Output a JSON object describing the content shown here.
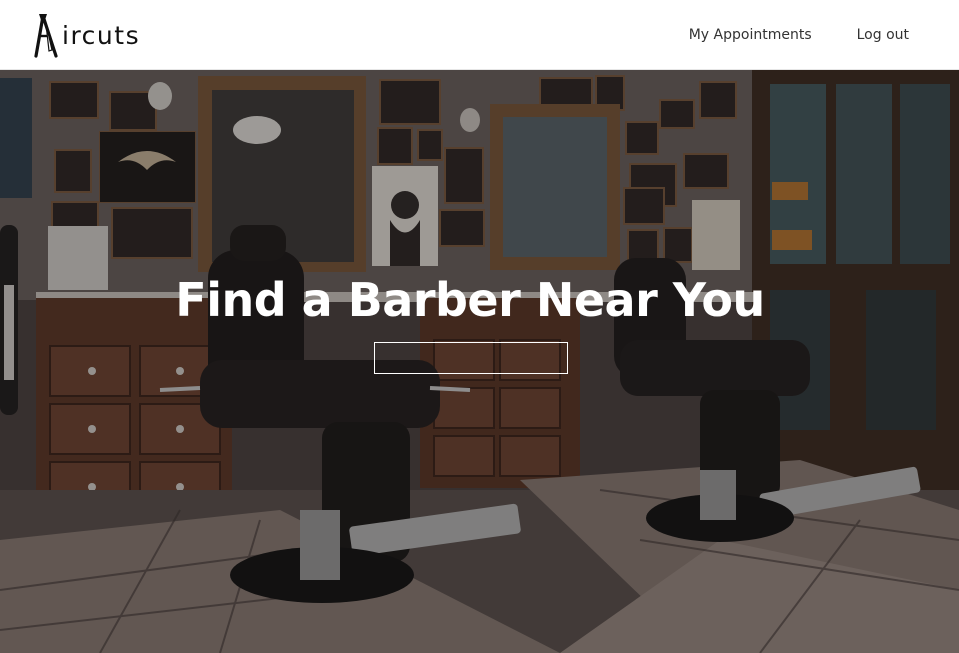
{
  "header": {
    "logo_text": "ircuts",
    "nav": {
      "appointments": "My Appointments",
      "logout": "Log out"
    }
  },
  "hero": {
    "title": "Find a Barber Near You",
    "button_label": ""
  },
  "colors": {
    "header_bg": "#ffffff",
    "hero_text": "#ffffff",
    "overlay": "#141212"
  }
}
